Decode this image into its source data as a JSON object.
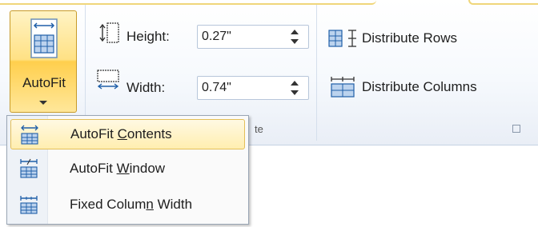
{
  "cell_size": {
    "autofit": {
      "label": "AutoFit",
      "icon": "table-autofit-icon"
    },
    "height": {
      "label": "Height:",
      "value": "0.27\"",
      "icon": "row-height-icon"
    },
    "width": {
      "label": "Width:",
      "value": "0.74\"",
      "icon": "column-width-icon"
    },
    "distribute_rows": {
      "label": "Distribute Rows",
      "icon": "distribute-rows-icon"
    },
    "distribute_columns": {
      "label": "Distribute Columns",
      "icon": "distribute-columns-icon"
    },
    "group_label_tail": "te"
  },
  "autofit_menu": {
    "items": [
      {
        "pre": "AutoFit ",
        "key": "C",
        "post": "ontents",
        "icon": "autofit-contents-icon",
        "selected": true
      },
      {
        "pre": "AutoFit ",
        "key": "W",
        "post": "indow",
        "icon": "autofit-window-icon",
        "selected": false
      },
      {
        "pre": "Fixed Colum",
        "key": "n",
        "post": " Width",
        "icon": "fixed-column-width-icon",
        "selected": false
      }
    ]
  },
  "colors": {
    "accent": "#ffd65c",
    "border": "#c89b2a",
    "icon_blue": "#1f5fa8"
  }
}
